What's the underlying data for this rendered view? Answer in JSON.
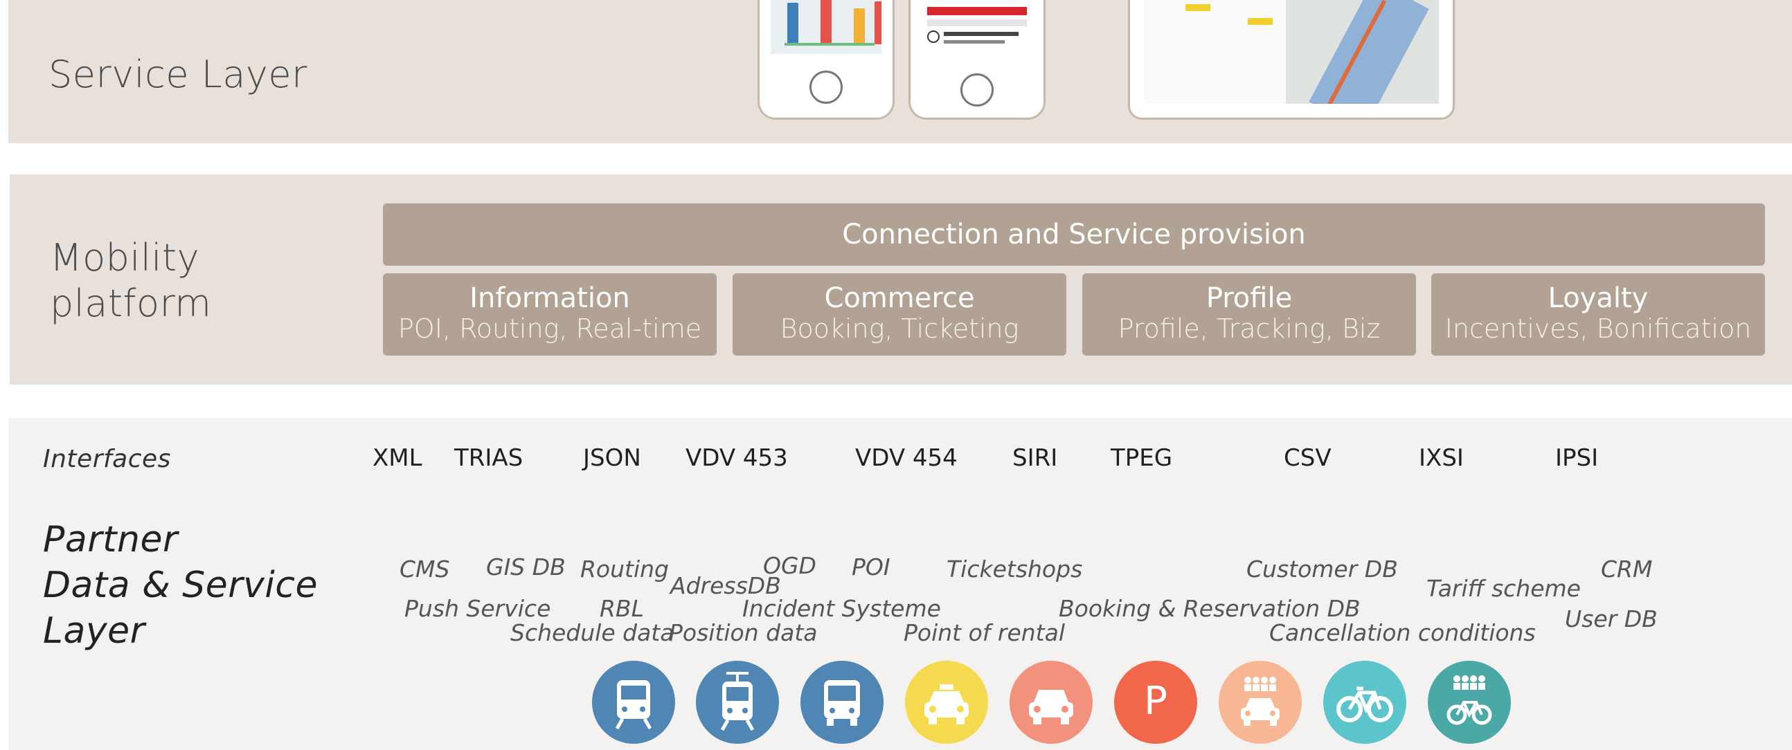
{
  "service_layer": {
    "title": "Service Layer"
  },
  "mobility_platform": {
    "title_line1": "Mobility",
    "title_line2": "platform",
    "connection_box": "Connection and Service provision",
    "boxes": [
      {
        "title": "Information",
        "subtitle": "POI, Routing, Real-time"
      },
      {
        "title": "Commerce",
        "subtitle": "Booking, Ticketing"
      },
      {
        "title": "Profile",
        "subtitle": "Profile, Tracking, Biz"
      },
      {
        "title": "Loyalty",
        "subtitle": "Incentives, Bonification"
      }
    ]
  },
  "interfaces": {
    "title": "Interfaces",
    "items": [
      "XML",
      "TRIAS",
      "JSON",
      "VDV 453",
      "VDV 454",
      "SIRI",
      "TPEG",
      "CSV",
      "IXSI",
      "IPSI"
    ]
  },
  "partner_layer": {
    "title_line1": "Partner",
    "title_line2": "Data & Service",
    "title_line3": "Layer",
    "items": [
      "CMS",
      "GIS DB",
      "Routing",
      "OGD",
      "POI",
      "Ticketshops",
      "Customer DB",
      "CRM",
      "AdressDB",
      "Tariff scheme",
      "Push Service",
      "RBL",
      "Incident Systeme",
      "Booking & Reservation DB",
      "User DB",
      "Schedule data",
      "Position data",
      "Point of rental",
      "Cancellation conditions"
    ]
  },
  "mode_icons": [
    {
      "name": "train-icon",
      "color": "#4f86b3"
    },
    {
      "name": "tram-icon",
      "color": "#4f86b3"
    },
    {
      "name": "bus-icon",
      "color": "#4f86b3"
    },
    {
      "name": "taxi-icon",
      "color": "#f5d94f"
    },
    {
      "name": "car-icon",
      "color": "#f2917c"
    },
    {
      "name": "parking-icon",
      "color": "#f2674a",
      "label": "P"
    },
    {
      "name": "carsharing-icon",
      "color": "#f7b694"
    },
    {
      "name": "bike-icon",
      "color": "#5cc5cc"
    },
    {
      "name": "bikesharing-icon",
      "color": "#4aa8a7"
    }
  ],
  "colors": {
    "band": "#e7e0db",
    "partner_band": "#f4f2f1",
    "box": "#b2a294"
  }
}
